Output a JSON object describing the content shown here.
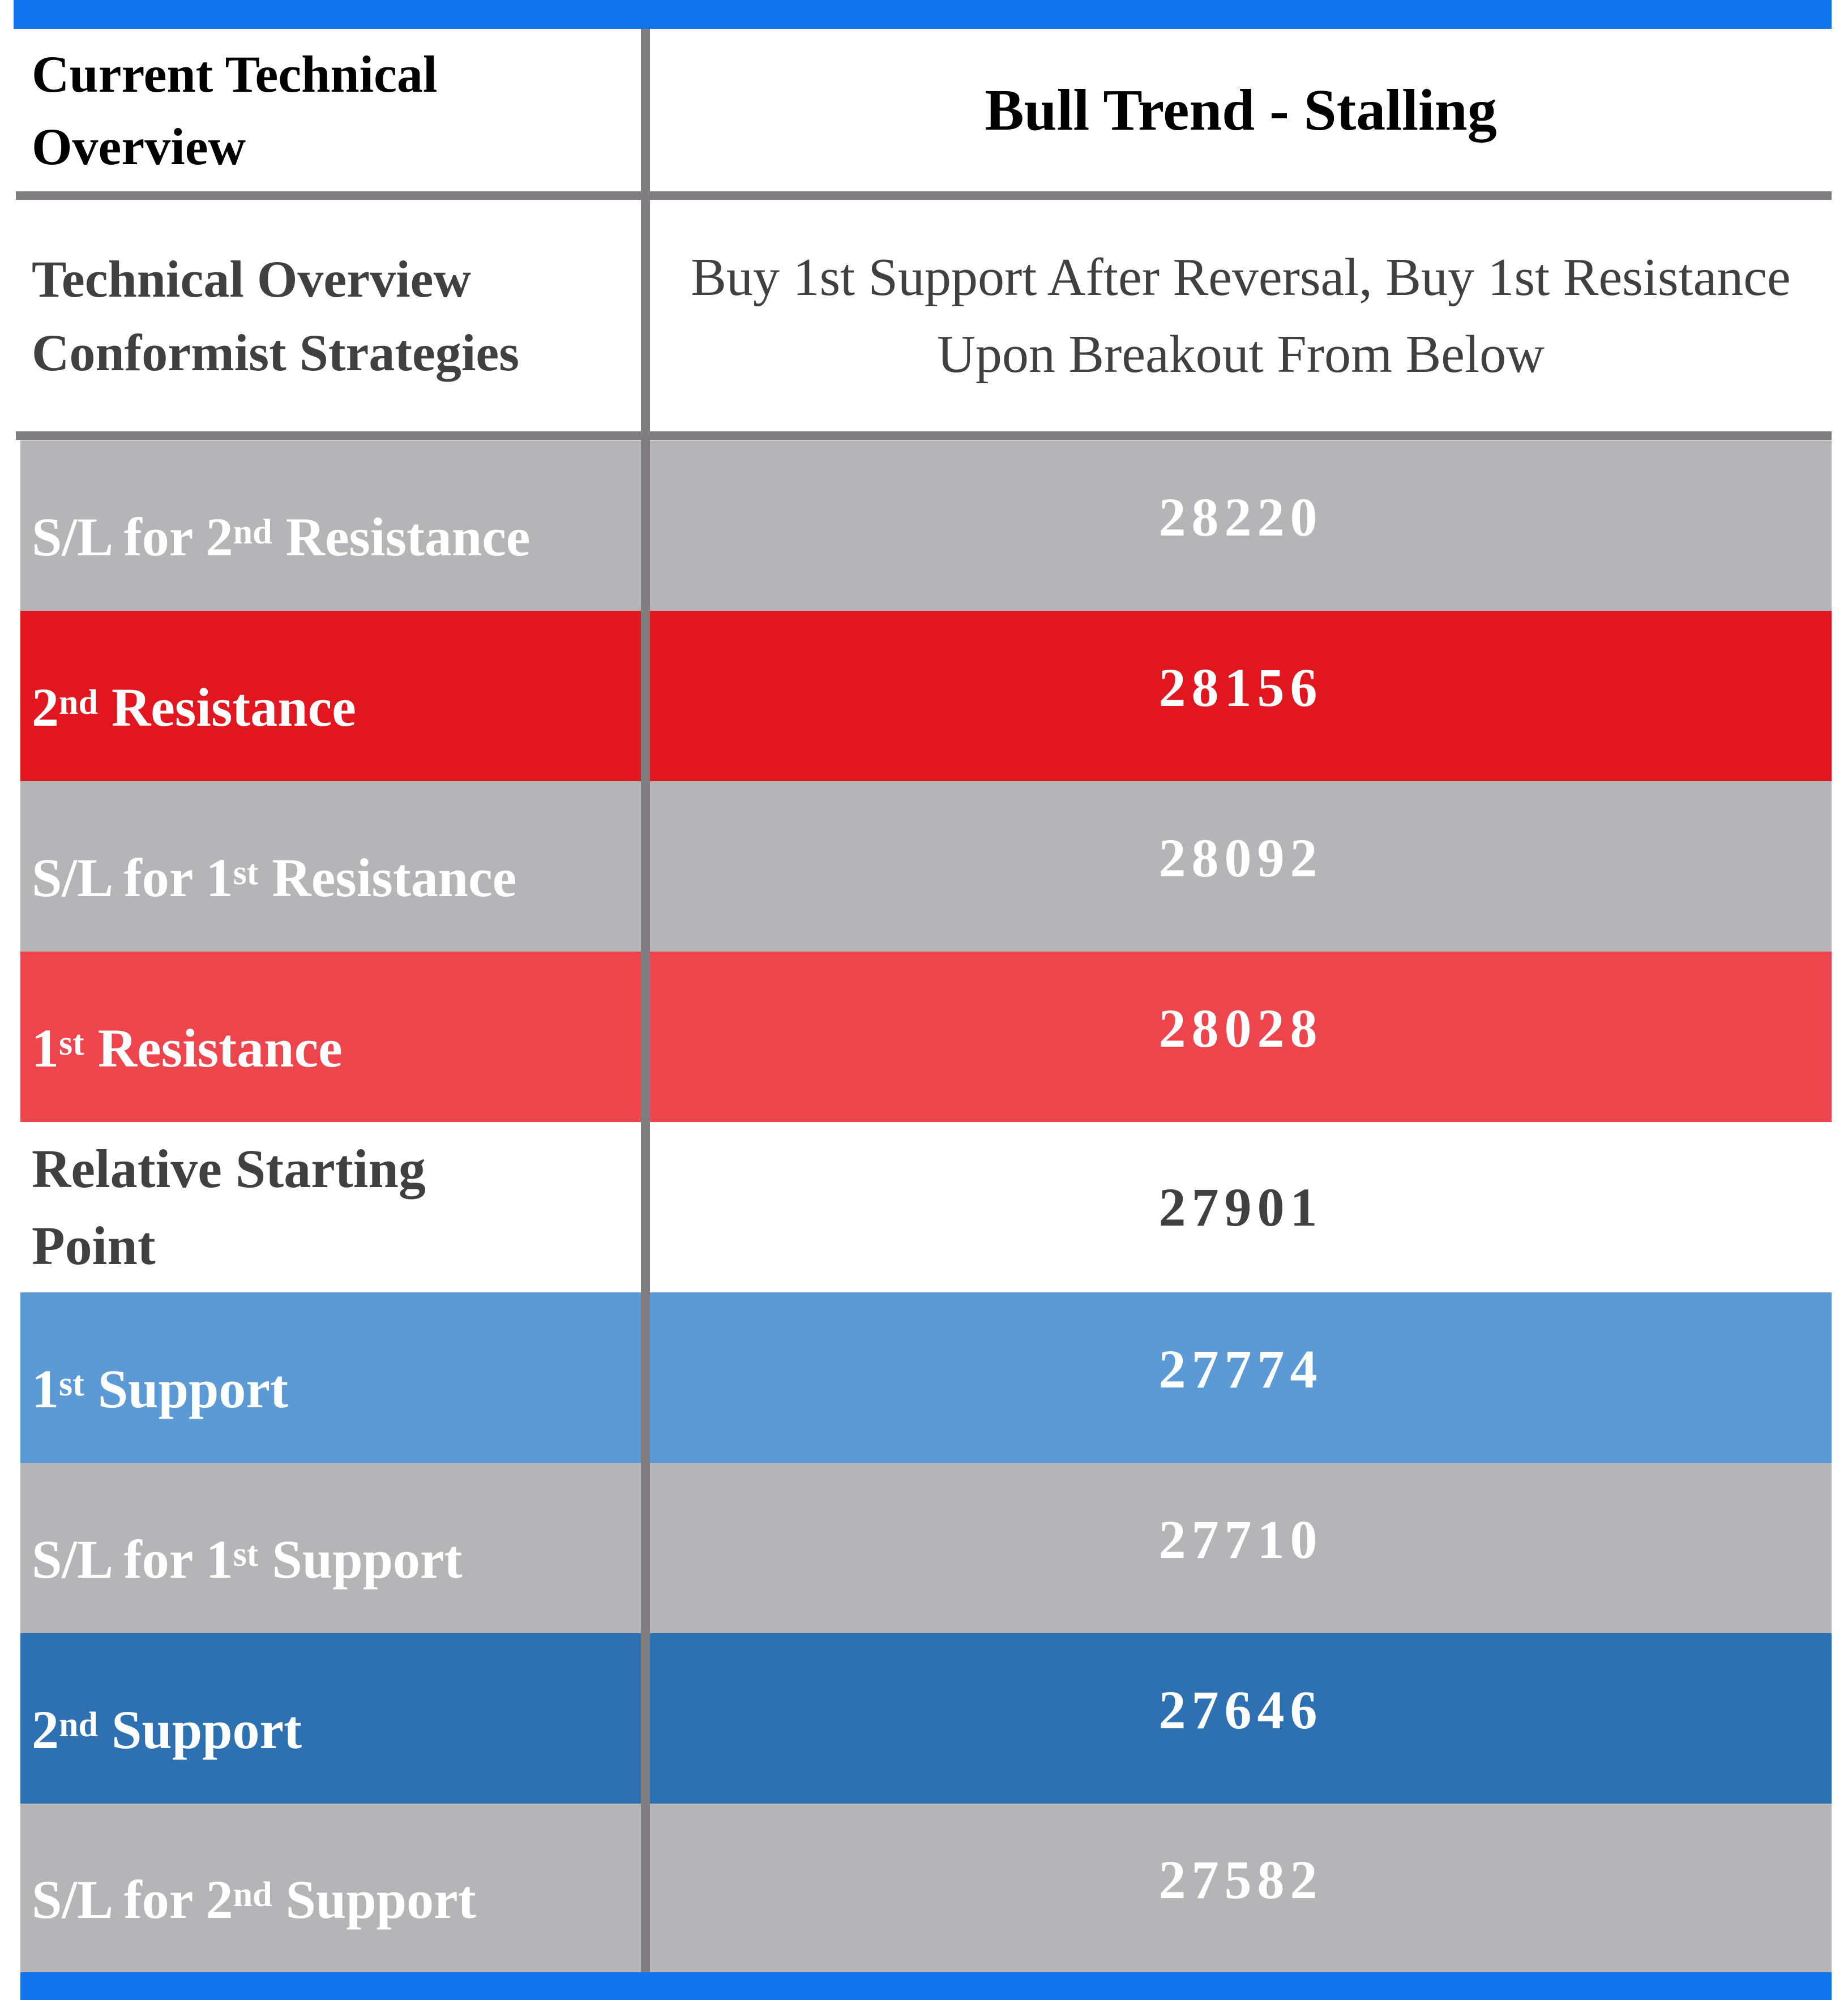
{
  "header": {
    "label": "Current Technical Overview",
    "value": "Bull Trend - Stalling"
  },
  "strategies": {
    "label": "Technical Overview Conformist Strategies",
    "value": "Buy 1st Support After Reversal, Buy 1st Resistance Upon Breakout From Below"
  },
  "colors": {
    "accent_bar": "#1174ED",
    "divider": "#807E80",
    "stop_loss": "#B5B4B6",
    "resistance_2": "#E1161E",
    "resistance_1": "#EE444C",
    "support_1": "#5B9AD5",
    "support_2": "#2E71B2",
    "starting_point": "#FFFFFF"
  },
  "rows": [
    {
      "prefix": "S/L for 2",
      "sup": "nd",
      "suffix": " Resistance",
      "value": "28220"
    },
    {
      "prefix": "2",
      "sup": "nd",
      "suffix": " Resistance",
      "value": "28156"
    },
    {
      "prefix": "S/L for 1",
      "sup": "st",
      "suffix": " Resistance",
      "value": "28092"
    },
    {
      "prefix": "1",
      "sup": "st",
      "suffix": " Resistance",
      "value": "28028"
    },
    {
      "prefix": "Relative Starting Point",
      "sup": "",
      "suffix": "",
      "value": "27901"
    },
    {
      "prefix": "1",
      "sup": "st",
      "suffix": " Support",
      "value": "27774"
    },
    {
      "prefix": "S/L for 1",
      "sup": "st",
      "suffix": " Support",
      "value": "27710"
    },
    {
      "prefix": "2",
      "sup": "nd",
      "suffix": " Support",
      "value": "27646"
    },
    {
      "prefix": "S/L for 2",
      "sup": "nd",
      "suffix": " Support",
      "value": "27582"
    }
  ]
}
